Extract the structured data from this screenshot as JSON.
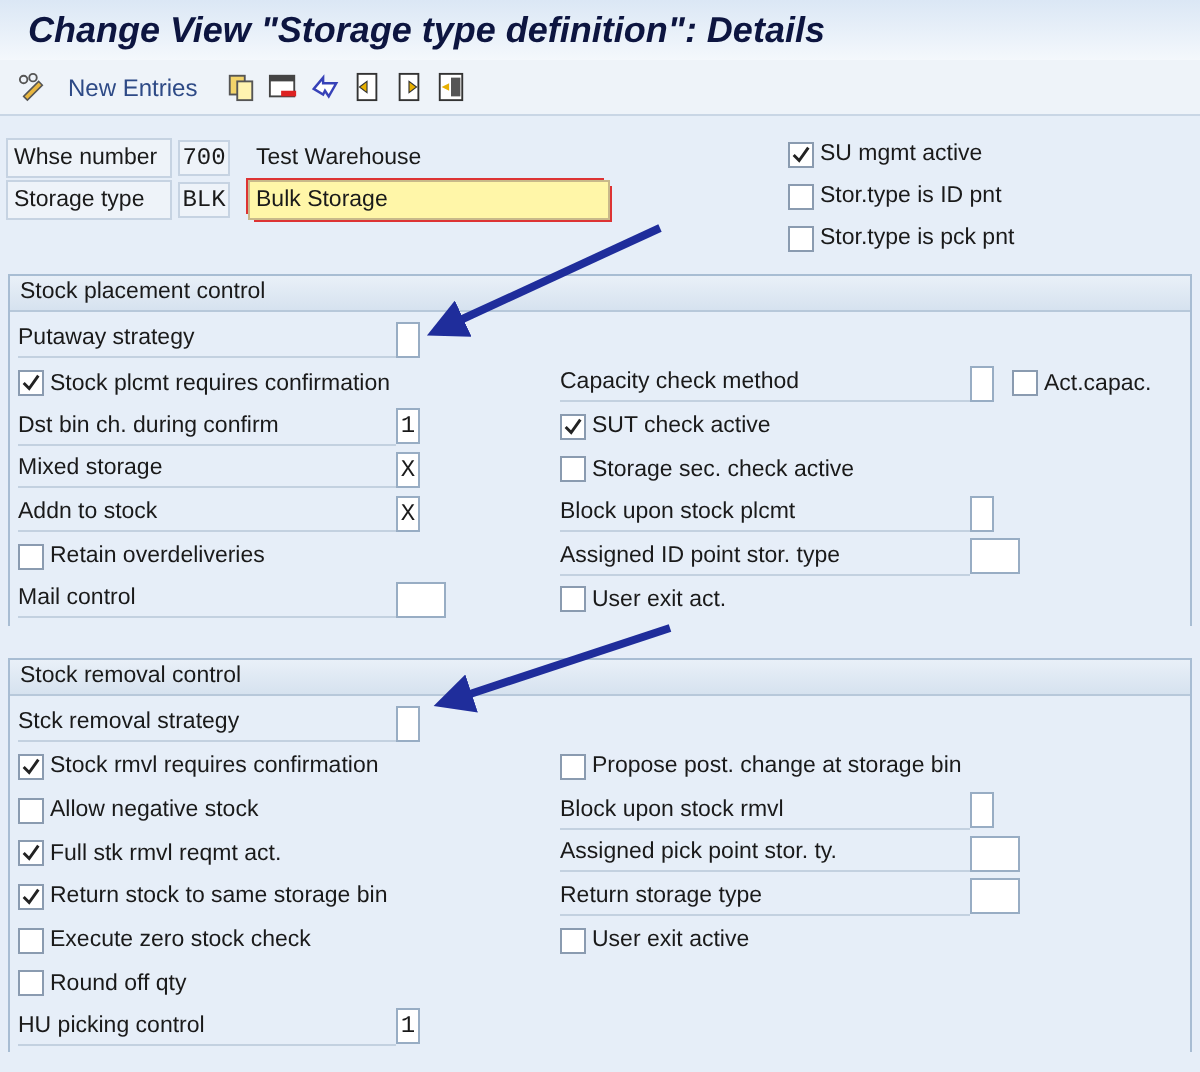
{
  "window": {
    "title": "Change View \"Storage type definition\": Details"
  },
  "toolbar": {
    "new_entries": "New Entries"
  },
  "header": {
    "whse_label": "Whse number",
    "whse_value": "700",
    "whse_text": "Test Warehouse",
    "type_label": "Storage type",
    "type_value": "BLK",
    "type_text": "Bulk Storage",
    "checks": [
      {
        "label": "SU mgmt active",
        "checked": true
      },
      {
        "label": "Stor.type is ID pnt",
        "checked": false
      },
      {
        "label": "Stor.type is pck pnt",
        "checked": false
      }
    ]
  },
  "sections": [
    {
      "title": "Stock placement control",
      "rows": [
        {
          "left": {
            "kind": "field",
            "label": "Putaway strategy",
            "wide": false
          }
        },
        {
          "left": {
            "kind": "check",
            "label": "Stock plcmt requires confirmation",
            "checked": true
          },
          "right": {
            "kind": "field",
            "label": "Capacity check method",
            "wide": false,
            "extra": {
              "label": "Act.capac.",
              "checked": false
            }
          }
        },
        {
          "left": {
            "kind": "field",
            "label": "Dst bin ch. during confirm",
            "wide": false,
            "value": "1"
          },
          "right": {
            "kind": "check",
            "label": "SUT check active",
            "checked": true
          }
        },
        {
          "left": {
            "kind": "field",
            "label": "Mixed storage",
            "wide": false,
            "value": "X"
          },
          "right": {
            "kind": "check",
            "label": "Storage sec. check active",
            "checked": false
          }
        },
        {
          "left": {
            "kind": "field",
            "label": "Addn to stock",
            "wide": false,
            "value": "X"
          },
          "right": {
            "kind": "field",
            "label": "Block upon stock plcmt",
            "wide": false
          }
        },
        {
          "left": {
            "kind": "check",
            "label": "Retain overdeliveries",
            "checked": false
          },
          "right": {
            "kind": "field",
            "label": "Assigned ID point stor. type",
            "wide": true
          }
        },
        {
          "left": {
            "kind": "field",
            "label": "Mail control",
            "wide": true
          },
          "right": {
            "kind": "check",
            "label": "User exit act.",
            "checked": false
          }
        }
      ]
    },
    {
      "title": "Stock removal control",
      "rows": [
        {
          "left": {
            "kind": "field",
            "label": "Stck removal strategy",
            "wide": false
          }
        },
        {
          "left": {
            "kind": "check",
            "label": "Stock rmvl requires confirmation",
            "checked": true
          },
          "right": {
            "kind": "check",
            "label": "Propose post. change at storage bin",
            "checked": false
          }
        },
        {
          "left": {
            "kind": "check",
            "label": "Allow negative stock",
            "checked": false
          },
          "right": {
            "kind": "field",
            "label": "Block upon stock rmvl",
            "wide": false
          }
        },
        {
          "left": {
            "kind": "check",
            "label": "Full stk rmvl reqmt act.",
            "checked": true
          },
          "right": {
            "kind": "field",
            "label": "Assigned pick point stor. ty.",
            "wide": true
          }
        },
        {
          "left": {
            "kind": "check",
            "label": "Return stock to same storage bin",
            "checked": true
          },
          "right": {
            "kind": "field",
            "label": "Return storage type",
            "wide": true
          }
        },
        {
          "left": {
            "kind": "check",
            "label": "Execute zero stock check",
            "checked": false
          },
          "right": {
            "kind": "check",
            "label": "User exit active",
            "checked": false
          }
        },
        {
          "left": {
            "kind": "check",
            "label": "Round off qty",
            "checked": false
          }
        },
        {
          "left": {
            "kind": "field",
            "label": "HU picking control",
            "wide": false,
            "value": "1"
          }
        }
      ]
    }
  ]
}
